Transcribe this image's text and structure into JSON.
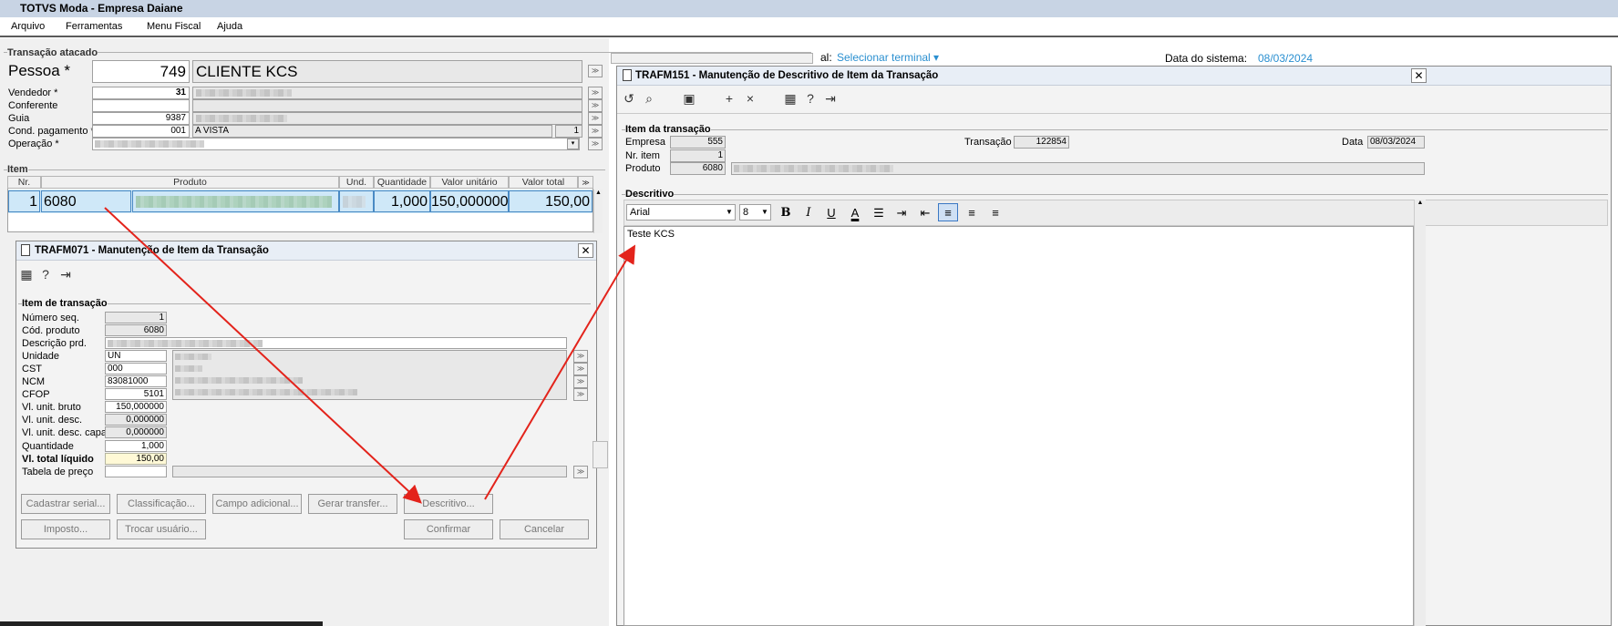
{
  "app": {
    "title": "TOTVS Moda - Empresa Daiane"
  },
  "menu": [
    "Arquivo",
    "Ferramentas",
    "Menu Fiscal",
    "Ajuda"
  ],
  "top_right": {
    "terminal_prefix": "al:",
    "terminal_link": "Selecionar terminal ▾",
    "date_label": "Data do sistema:",
    "date_value": "08/03/2024"
  },
  "main": {
    "group_title": "Transação atacado",
    "pessoa_label": "Pessoa *",
    "pessoa_code": "749",
    "pessoa_name": "CLIENTE  KCS",
    "vendedor_label": "Vendedor *",
    "vendedor_code": "31",
    "conferente_label": "Conferente",
    "guia_label": "Guia",
    "guia_code": "9387",
    "cond_label": "Cond. pagamento *",
    "cond_code": "001",
    "cond_name": "A VISTA",
    "cond_extra": "1",
    "operacao_label": "Operação *",
    "item_group": "Item",
    "columns": [
      "Nr.",
      "Produto",
      "Und.",
      "Quantidade",
      "Valor unitário",
      "Valor total"
    ],
    "row": {
      "nr": "1",
      "produto": "6080",
      "quantidade": "1,000",
      "valor_unit": "150,000000",
      "valor_total": "150,00"
    }
  },
  "dlg071": {
    "title": "TRAFM071 - Manutenção de Item da Transação",
    "group": "Item de transação",
    "fields": [
      {
        "label": "Número seq.",
        "value": "1"
      },
      {
        "label": "Cód. produto",
        "value": "6080"
      },
      {
        "label": "Descrição prd.",
        "value": ""
      },
      {
        "label": "Unidade",
        "value": "UN"
      },
      {
        "label": "CST",
        "value": "000"
      },
      {
        "label": "NCM",
        "value": "83081000"
      },
      {
        "label": "CFOP",
        "value": "5101"
      },
      {
        "label": "Vl. unit. bruto",
        "value": "150,000000"
      },
      {
        "label": "Vl. unit. desc.",
        "value": "0,000000"
      },
      {
        "label": "Vl. unit. desc. capa",
        "value": "0,000000"
      },
      {
        "label": "Quantidade",
        "value": "1,000"
      },
      {
        "label": "Vl. total líquido",
        "value": "150,00"
      },
      {
        "label": "Tabela de preço",
        "value": ""
      }
    ],
    "buttons_row1": [
      "Cadastrar serial...",
      "Classificação...",
      "Campo adicional...",
      "Gerar transfer...",
      "Descritivo..."
    ],
    "buttons_row2": [
      "Imposto...",
      "Trocar usuário..."
    ],
    "confirm": "Confirmar",
    "cancel": "Cancelar"
  },
  "dlg151": {
    "title": "TRAFM151 - Manutenção de Descritivo de Item da Transação",
    "group": "Item da transação",
    "empresa_label": "Empresa",
    "empresa": "555",
    "nritem_label": "Nr. item",
    "nritem": "1",
    "produto_label": "Produto",
    "produto": "6080",
    "transacao_label": "Transação",
    "transacao": "122854",
    "data_label": "Data",
    "data": "08/03/2024",
    "desc_group": "Descritivo",
    "font": "Arial",
    "size": "8",
    "text": "Teste KCS"
  }
}
